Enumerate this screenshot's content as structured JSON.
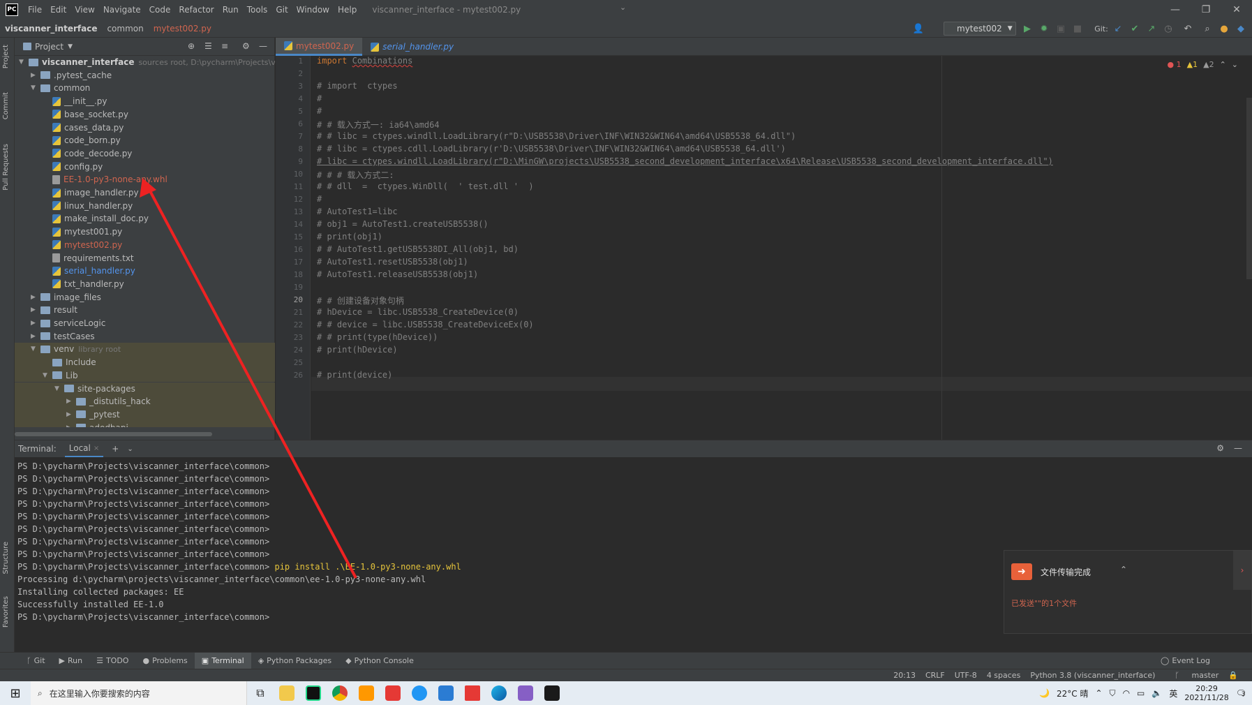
{
  "titlebar": {
    "menu": [
      "File",
      "Edit",
      "View",
      "Navigate",
      "Code",
      "Refactor",
      "Run",
      "Tools",
      "Git",
      "Window",
      "Help"
    ],
    "window_title": "viscanner_interface - mytest002.py"
  },
  "navbar": {
    "crumbs": [
      "viscanner_interface",
      "common",
      "mytest002.py"
    ],
    "run_config": "mytest002",
    "git_label": "Git:"
  },
  "left_strip": {
    "tabs": [
      "Project",
      "Commit",
      "Pull Requests",
      "Structure",
      "Favorites"
    ]
  },
  "project": {
    "header": "Project",
    "root": {
      "name": "viscanner_interface",
      "sub": "sources root, D:\\pycharm\\Projects\\visca"
    },
    "items": [
      {
        "name": ".pytest_cache",
        "kind": "folder",
        "depth": 1,
        "arrow": "▶"
      },
      {
        "name": "common",
        "kind": "folder",
        "depth": 1,
        "arrow": "▼"
      },
      {
        "name": "__init__.py",
        "kind": "py",
        "depth": 2
      },
      {
        "name": "base_socket.py",
        "kind": "py",
        "depth": 2
      },
      {
        "name": "cases_data.py",
        "kind": "py",
        "depth": 2
      },
      {
        "name": "code_born.py",
        "kind": "py",
        "depth": 2
      },
      {
        "name": "code_decode.py",
        "kind": "py",
        "depth": 2
      },
      {
        "name": "config.py",
        "kind": "py",
        "depth": 2
      },
      {
        "name": "EE-1.0-py3-none-any.whl",
        "kind": "txt",
        "depth": 2,
        "color": "#d0654f"
      },
      {
        "name": "image_handler.py",
        "kind": "py",
        "depth": 2
      },
      {
        "name": "linux_handler.py",
        "kind": "py",
        "depth": 2
      },
      {
        "name": "make_install_doc.py",
        "kind": "py",
        "depth": 2
      },
      {
        "name": "mytest001.py",
        "kind": "py",
        "depth": 2
      },
      {
        "name": "mytest002.py",
        "kind": "py",
        "depth": 2,
        "color": "#d0654f"
      },
      {
        "name": "requirements.txt",
        "kind": "txt",
        "depth": 2
      },
      {
        "name": "serial_handler.py",
        "kind": "py",
        "depth": 2,
        "color": "#5394ec"
      },
      {
        "name": "txt_handler.py",
        "kind": "py",
        "depth": 2
      },
      {
        "name": "image_files",
        "kind": "folder",
        "depth": 1,
        "arrow": "▶"
      },
      {
        "name": "result",
        "kind": "folder",
        "depth": 1,
        "arrow": "▶"
      },
      {
        "name": "serviceLogic",
        "kind": "folder",
        "depth": 1,
        "arrow": "▶"
      },
      {
        "name": "testCases",
        "kind": "folder",
        "depth": 1,
        "arrow": "▶"
      },
      {
        "name": "venv",
        "kind": "folder",
        "depth": 1,
        "arrow": "▼",
        "sub": "library root",
        "lib": true
      },
      {
        "name": "Include",
        "kind": "folder",
        "depth": 2,
        "lib": true
      },
      {
        "name": "Lib",
        "kind": "folder",
        "depth": 2,
        "arrow": "▼",
        "lib": true
      },
      {
        "name": "site-packages",
        "kind": "folder",
        "depth": 3,
        "arrow": "▼",
        "lib": true
      },
      {
        "name": "_distutils_hack",
        "kind": "folder",
        "depth": 4,
        "arrow": "▶",
        "lib": true
      },
      {
        "name": "_pytest",
        "kind": "folder",
        "depth": 4,
        "arrow": "▶",
        "lib": true
      },
      {
        "name": "adodbapi",
        "kind": "folder",
        "depth": 4,
        "arrow": "▶",
        "lib": true
      }
    ]
  },
  "editor": {
    "tabs": [
      {
        "label": "mytest002.py",
        "active": true
      },
      {
        "label": "serial_handler.py",
        "active": false
      }
    ],
    "inspections": [
      "1",
      "1",
      "2"
    ],
    "lines": [
      "import Combinations",
      "",
      "# import  ctypes",
      "#",
      "#",
      "# # 载入方式一: ia64\\amd64",
      "# # libc = ctypes.windll.LoadLibrary(r\"D:\\USB5538\\Driver\\INF\\WIN32&WIN64\\amd64\\USB5538_64.dll\")",
      "# # libc = ctypes.cdll.LoadLibrary(r'D:\\USB5538\\Driver\\INF\\WIN32&WIN64\\amd64\\USB5538_64.dll')",
      "# libc = ctypes.windll.LoadLibrary(r\"D:\\MinGW\\projects\\USB5538_second_development_interface\\x64\\Release\\USB5538_second_development_interface.dll\")",
      "# # # 载入方式二:",
      "# # dll  =  ctypes.WinDll(  ' test.dll '  )",
      "#",
      "# AutoTest1=libc",
      "# obj1 = AutoTest1.createUSB5538()",
      "# print(obj1)",
      "# # AutoTest1.getUSB5538DI_All(obj1, bd)",
      "# AutoTest1.resetUSB5538(obj1)",
      "# AutoTest1.releaseUSB5538(obj1)",
      "",
      "# # 创建设备对象句柄",
      "# hDevice = libc.USB5538_CreateDevice(0)",
      "# # device = libc.USB5538_CreateDeviceEx(0)",
      "# # print(type(hDevice))",
      "# print(hDevice)",
      "",
      "# print(device)"
    ],
    "line_numbers": [
      "1",
      "2",
      "3",
      "4",
      "5",
      "6",
      "7",
      "8",
      "9",
      "10",
      "11",
      "12",
      "13",
      "14",
      "15",
      "16",
      "17",
      "18",
      "19",
      "20",
      "21",
      "22",
      "23",
      "24",
      "25",
      "26"
    ]
  },
  "terminal": {
    "header": "Terminal:",
    "tab": "Local",
    "prompt": "PS D:\\pycharm\\Projects\\viscanner_interface\\common>",
    "empty_prompts": 8,
    "command": "pip install .\\EE-1.0-py3-none-any.whl",
    "output": [
      "Processing d:\\pycharm\\projects\\viscanner_interface\\common\\ee-1.0-py3-none-any.whl",
      "Installing collected packages: EE",
      "Successfully installed EE-1.0"
    ]
  },
  "bottom_tabs": [
    "Git",
    "Run",
    "TODO",
    "Problems",
    "Terminal",
    "Python Packages",
    "Python Console"
  ],
  "event_log": "Event Log",
  "status": [
    "20:13",
    "CRLF",
    "UTF-8",
    "4 spaces",
    "Python 3.8 (viscanner_interface)",
    "master"
  ],
  "notification": {
    "title": "文件传输完成",
    "body": "已发送\"\"的1个文件"
  },
  "taskbar": {
    "search_placeholder": "在这里输入你要搜索的内容",
    "weather": "22°C 晴",
    "ime": "英",
    "time": "20:29",
    "date": "2021/11/28",
    "badge": "3"
  },
  "colors": {
    "accent": "#4a88c7",
    "modified": "#d0654f",
    "arrow": "#ee2222"
  }
}
